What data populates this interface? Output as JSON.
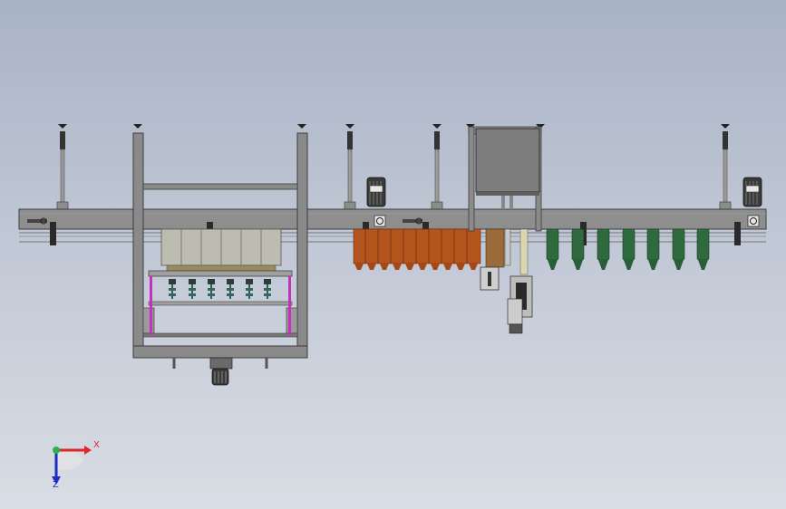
{
  "window": {
    "title": ""
  },
  "axes": {
    "x_label": "X",
    "y_label": "Z"
  },
  "colors": {
    "background_top": "#a9b3c6",
    "background_bottom": "#d9dde4",
    "frame": "#8a8a8a",
    "frame_dark": "#4a4a4a",
    "orange_bottles": "#b5551e",
    "green_bottles": "#2f6a3f",
    "magenta_rails": "#c82fc0",
    "axis_x": "#e0262b",
    "axis_y": "#1c2fc0",
    "axis_origin": "#2bb34a"
  },
  "model": {
    "components": [
      "conveyor-beam",
      "support-posts",
      "capping-frame",
      "filling-heads",
      "orange-bottle-row",
      "green-bottle-row",
      "fill-station",
      "drive-motors",
      "triad"
    ]
  }
}
